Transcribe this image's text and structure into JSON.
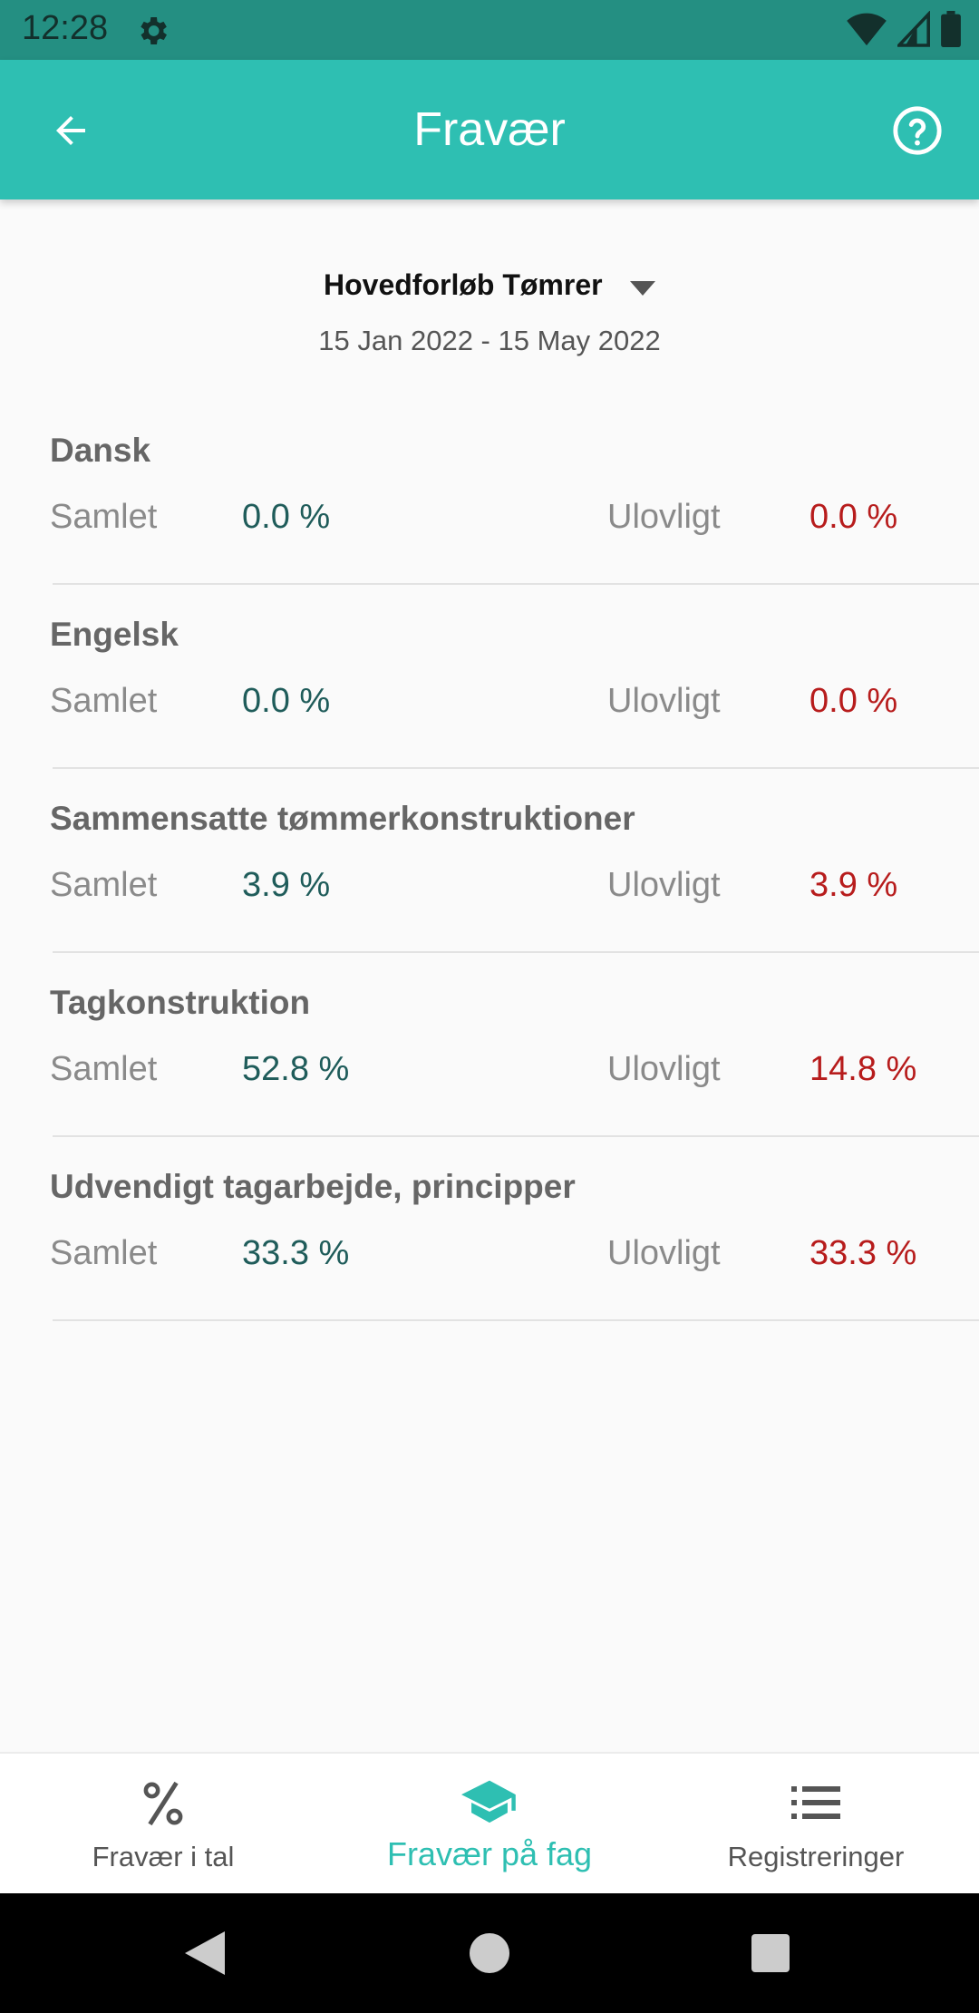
{
  "status_bar": {
    "time": "12:28"
  },
  "app_bar": {
    "title": "Fravær"
  },
  "course": {
    "name": "Hovedforløb Tømrer",
    "date_range": "15 Jan 2022 - 15 May 2022"
  },
  "labels": {
    "total": "Samlet",
    "illegal": "Ulovligt"
  },
  "subjects": [
    {
      "name": "Dansk",
      "total": "0.0 %",
      "illegal": "0.0 %"
    },
    {
      "name": "Engelsk",
      "total": "0.0 %",
      "illegal": "0.0 %"
    },
    {
      "name": "Sammensatte tømmerkonstruktioner",
      "total": "3.9 %",
      "illegal": "3.9 %"
    },
    {
      "name": "Tagkonstruktion",
      "total": "52.8 %",
      "illegal": "14.8 %"
    },
    {
      "name": "Udvendigt tagarbejde, principper",
      "total": "33.3 %",
      "illegal": "33.3 %"
    }
  ],
  "bottom_nav": {
    "items": [
      {
        "label": "Fravær i tal",
        "icon": "percent-icon"
      },
      {
        "label": "Fravær på fag",
        "icon": "graduation-cap-icon"
      },
      {
        "label": "Registreringer",
        "icon": "list-icon"
      }
    ],
    "active_index": 1
  },
  "colors": {
    "primary": "#2ebfb2",
    "status_bar": "#248f82",
    "total_value": "#1f5c5a",
    "illegal_value": "#b71c1c"
  }
}
